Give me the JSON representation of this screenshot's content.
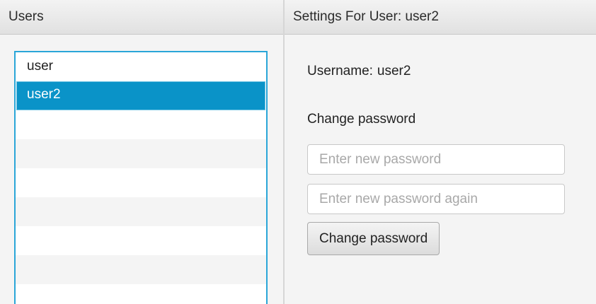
{
  "users_panel": {
    "title": "Users",
    "items": [
      {
        "label": "user",
        "selected": false
      },
      {
        "label": "user2",
        "selected": true
      }
    ],
    "selection_color": "#0a93c8",
    "border_color": "#2aa6d8"
  },
  "settings_panel": {
    "title_prefix": "Settings For User:",
    "title_user": "user2",
    "username_label": "Username:",
    "username_value": "user2",
    "change_password_heading": "Change password",
    "new_password_placeholder": "Enter new password",
    "new_password_value": "",
    "repeat_password_placeholder": "Enter new password again",
    "repeat_password_value": "",
    "submit_label": "Change password"
  }
}
